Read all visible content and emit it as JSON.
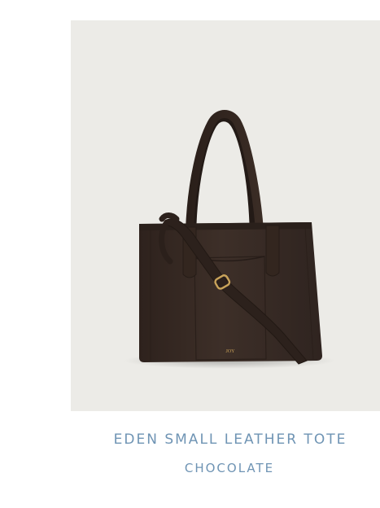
{
  "product": {
    "name": "EDEN SMALL LEATHER TOTE",
    "color": "CHOCOLATE",
    "image_alt": "Eden small leather tote in chocolate",
    "monogram": "JOY",
    "accent_color": "#6f94b4",
    "bag_color": "#3b2d26"
  }
}
